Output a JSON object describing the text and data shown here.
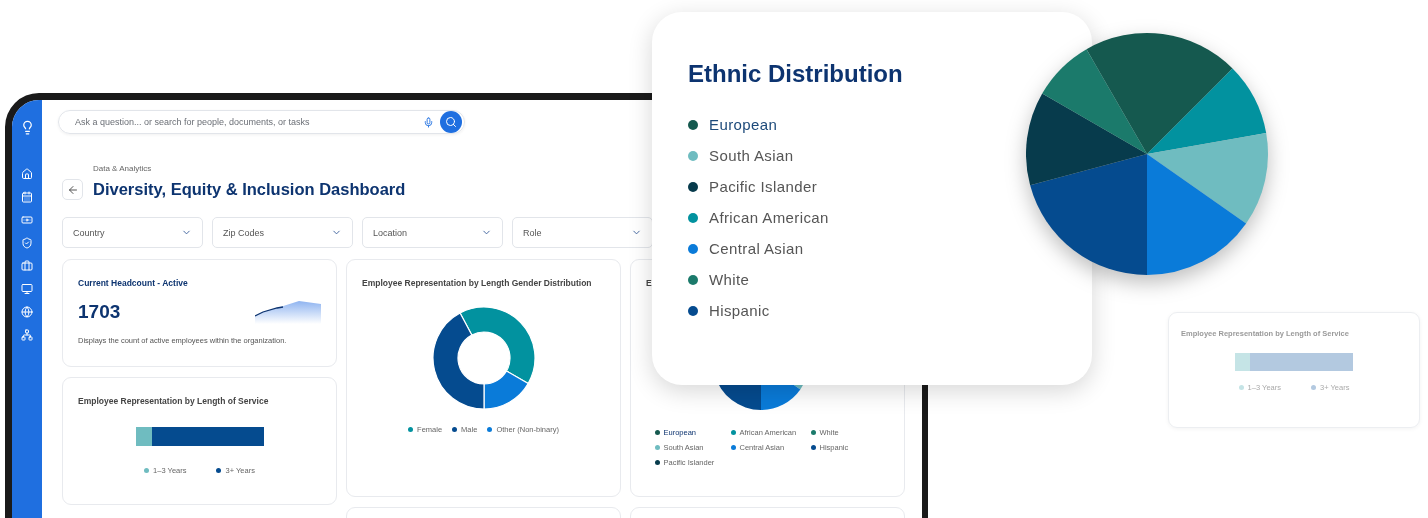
{
  "search": {
    "placeholder": "Ask a question... or search for people, documents, or tasks"
  },
  "breadcrumb": "Data & Analytics",
  "title": "Diversity, Equity & Inclusion Dashboard",
  "filters": [
    {
      "label": "Country"
    },
    {
      "label": "Zip Codes"
    },
    {
      "label": "Location"
    },
    {
      "label": "Role"
    }
  ],
  "headcount_card": {
    "title": "Current Headcount - Active",
    "value": "1703",
    "description": "Displays the count of active employees within the organization."
  },
  "service_card": {
    "title": "Employee Representation by Length of Service",
    "legend": [
      {
        "label": "1–3 Years",
        "color": "#6fbcc0"
      },
      {
        "label": "3+ Years",
        "color": "#054b8f"
      }
    ]
  },
  "gender_card": {
    "title": "Employee Representation by Length Gender Distribution",
    "legend": [
      {
        "label": "Female",
        "color": "#02929f"
      },
      {
        "label": "Male",
        "color": "#054b8f"
      },
      {
        "label": "Other (Non-binary)",
        "color": "#0a7bd9"
      }
    ]
  },
  "ethnic_card": {
    "title": "E",
    "legend": [
      {
        "label": "European",
        "color": "#15594f"
      },
      {
        "label": "African American",
        "color": "#02929f"
      },
      {
        "label": "White",
        "color": "#1b7a6b"
      },
      {
        "label": "South Asian",
        "color": "#6fbcc0"
      },
      {
        "label": "Central Asian",
        "color": "#0a7bd9"
      },
      {
        "label": "Hispanic",
        "color": "#054b8f"
      },
      {
        "label": "Pacific Islander",
        "color": "#073b4c"
      }
    ]
  },
  "ethnic_popup": {
    "title": "Ethnic Distribution",
    "legend": [
      {
        "label": "European",
        "color": "#15594f"
      },
      {
        "label": "South Asian",
        "color": "#6fbcc0"
      },
      {
        "label": "Pacific Islander",
        "color": "#073b4c"
      },
      {
        "label": "African American",
        "color": "#02929f"
      },
      {
        "label": "Central Asian",
        "color": "#0a7bd9"
      },
      {
        "label": "White",
        "color": "#1b7a6b"
      },
      {
        "label": "Hispanic",
        "color": "#054b8f"
      }
    ]
  },
  "faded_card": {
    "title": "Employee Representation by Length of Service",
    "legend": [
      {
        "label": "1–3 Years",
        "color": "#c5e4e6"
      },
      {
        "label": "3+ Years",
        "color": "#b3c9e0"
      }
    ]
  }
}
